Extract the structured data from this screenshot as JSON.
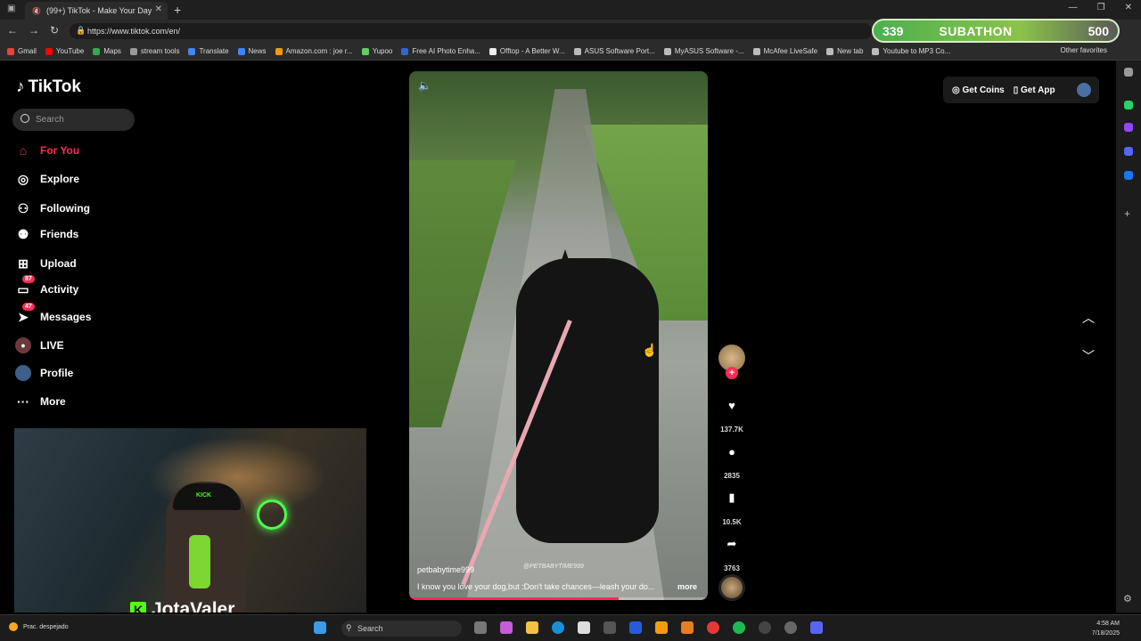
{
  "browser": {
    "tab_title": "(99+) TikTok - Make Your Day",
    "url": "https://www.tiktok.com/en/",
    "bookmarks": [
      "Gmail",
      "YouTube",
      "Maps",
      "stream tools",
      "Translate",
      "News",
      "Amazon.com : joe r...",
      "Yupoo",
      "Free AI Photo Enha...",
      "Offtop - A Better W...",
      "ASUS Software Port...",
      "MyASUS Software -...",
      "McAfee LiveSafe",
      "New tab",
      "Youtube to MP3 Co..."
    ],
    "other_favorites": "Other favorites"
  },
  "overlay": {
    "left_count": "339",
    "label": "SUBATHON",
    "right_count": "500"
  },
  "tiktok": {
    "logo": "TikTok",
    "search_placeholder": "Search",
    "nav": [
      {
        "label": "For You",
        "icon": "home-icon",
        "active": true
      },
      {
        "label": "Explore",
        "icon": "compass-icon"
      },
      {
        "label": "Following",
        "icon": "following-icon"
      },
      {
        "label": "Friends",
        "icon": "friends-icon"
      },
      {
        "label": "Upload",
        "icon": "upload-icon"
      },
      {
        "label": "Activity",
        "icon": "activity-icon",
        "badge": "87"
      },
      {
        "label": "Messages",
        "icon": "messages-icon",
        "badge": "47"
      },
      {
        "label": "LIVE",
        "icon": "live-icon"
      },
      {
        "label": "Profile",
        "icon": "profile-icon"
      },
      {
        "label": "More",
        "icon": "more-icon"
      }
    ],
    "get_coins": "Get Coins",
    "get_app": "Get App",
    "video": {
      "username": "petbabytime999",
      "watermark": "@PETBABYTIME999",
      "caption": "I know you love your dog,but :Don't take chances—leash your do...",
      "more": "more",
      "progress": 0.7
    },
    "actions": {
      "likes": "137.7K",
      "comments": "2835",
      "saves": "10.5K",
      "shares": "3763"
    }
  },
  "webcam": {
    "streamer_name": "JotaValer",
    "cap_text": "KICK"
  },
  "taskbar": {
    "weather": "Prac. despejado",
    "search": "Search",
    "time": "4:58 AM",
    "date": "7/18/2025"
  },
  "colors": {
    "accent": "#fe2c55",
    "kick_green": "#53fc18"
  }
}
